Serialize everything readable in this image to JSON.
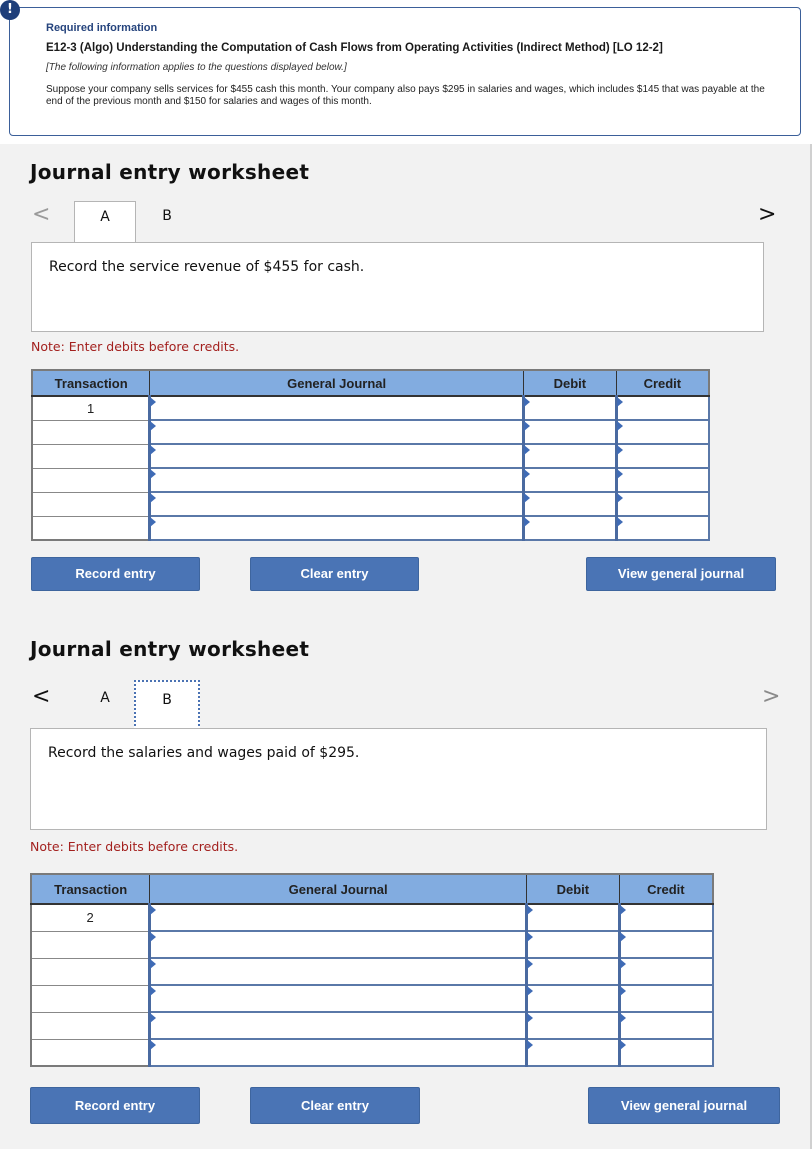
{
  "info": {
    "alert_icon": "!",
    "required_label": "Required information",
    "title": "E12-3 (Algo) Understanding the Computation of Cash Flows from Operating Activities (Indirect Method) [LO 12-2]",
    "applies_note": "[The following information applies to the questions displayed below.]",
    "scenario": "Suppose your company sells services for $455 cash this month. Your company also pays $295 in salaries and wages, which includes $145 that was payable at the end of the previous month and $150 for salaries and wages of this month."
  },
  "worksheets": [
    {
      "title": "Journal entry worksheet",
      "prev_icon": "‹",
      "next_icon": "›",
      "tabs": [
        {
          "label": "A",
          "active": true
        },
        {
          "label": "B",
          "active": false
        }
      ],
      "prompt": "Record the service revenue of $455 for cash.",
      "note": "Note: Enter debits before credits.",
      "columns": [
        "Transaction",
        "General Journal",
        "Debit",
        "Credit"
      ],
      "rows": [
        {
          "transaction": "1",
          "account": "",
          "debit": "",
          "credit": ""
        },
        {
          "transaction": "",
          "account": "",
          "debit": "",
          "credit": ""
        },
        {
          "transaction": "",
          "account": "",
          "debit": "",
          "credit": ""
        },
        {
          "transaction": "",
          "account": "",
          "debit": "",
          "credit": ""
        },
        {
          "transaction": "",
          "account": "",
          "debit": "",
          "credit": ""
        },
        {
          "transaction": "",
          "account": "",
          "debit": "",
          "credit": ""
        }
      ],
      "buttons": {
        "record": "Record entry",
        "clear": "Clear entry",
        "view": "View general journal"
      }
    },
    {
      "title": "Journal entry worksheet",
      "prev_icon": "‹",
      "next_icon": "›",
      "tabs": [
        {
          "label": "A",
          "active": false
        },
        {
          "label": "B",
          "active": true
        }
      ],
      "prompt": "Record the salaries and wages paid of $295.",
      "note": "Note: Enter debits before credits.",
      "columns": [
        "Transaction",
        "General Journal",
        "Debit",
        "Credit"
      ],
      "rows": [
        {
          "transaction": "2",
          "account": "",
          "debit": "",
          "credit": ""
        },
        {
          "transaction": "",
          "account": "",
          "debit": "",
          "credit": ""
        },
        {
          "transaction": "",
          "account": "",
          "debit": "",
          "credit": ""
        },
        {
          "transaction": "",
          "account": "",
          "debit": "",
          "credit": ""
        },
        {
          "transaction": "",
          "account": "",
          "debit": "",
          "credit": ""
        },
        {
          "transaction": "",
          "account": "",
          "debit": "",
          "credit": ""
        }
      ],
      "buttons": {
        "record": "Record entry",
        "clear": "Clear entry",
        "view": "View general journal"
      }
    }
  ]
}
